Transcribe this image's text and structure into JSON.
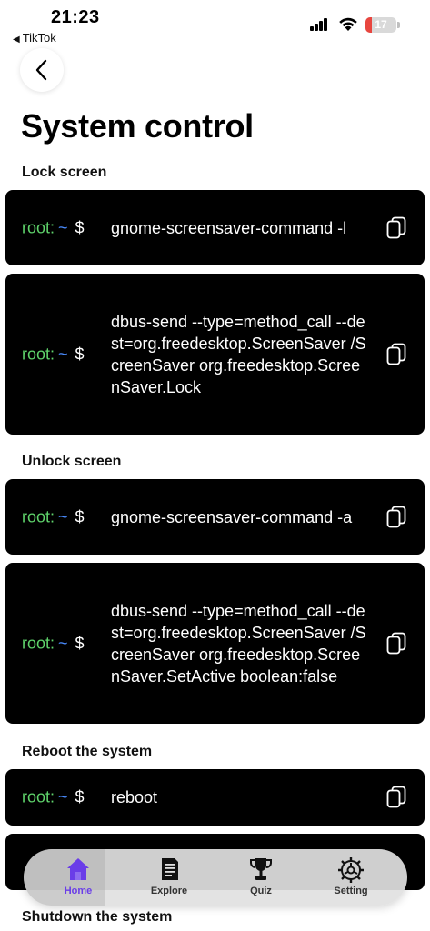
{
  "status_bar": {
    "time": "21:23",
    "back_app": "TikTok",
    "battery": "17"
  },
  "page": {
    "title": "System control"
  },
  "sections": [
    {
      "label": "Lock screen",
      "commands": [
        {
          "user": "root:",
          "tilde": "~",
          "dollar": "$",
          "text": "gnome-screensaver-command -l"
        },
        {
          "user": "root:",
          "tilde": "~",
          "dollar": "$",
          "text": "dbus-send --type=method_call --dest=org.freedesktop.ScreenSaver /ScreenSaver org.freedesktop.ScreenSaver.Lock"
        }
      ]
    },
    {
      "label": "Unlock screen",
      "commands": [
        {
          "user": "root:",
          "tilde": "~",
          "dollar": "$",
          "text": "gnome-screensaver-command -a"
        },
        {
          "user": "root:",
          "tilde": "~",
          "dollar": "$",
          "text": "dbus-send --type=method_call --dest=org.freedesktop.ScreenSaver /ScreenSaver org.freedesktop.ScreenSaver.SetActive boolean:false"
        }
      ]
    },
    {
      "label": "Reboot the system",
      "commands": [
        {
          "user": "root:",
          "tilde": "~",
          "dollar": "$",
          "text": "reboot"
        }
      ]
    },
    {
      "label": "Shutdown the system"
    }
  ],
  "tab_bar": {
    "tabs": [
      {
        "label": "Home",
        "icon": "home-icon",
        "active": true
      },
      {
        "label": "Explore",
        "icon": "document-icon"
      },
      {
        "label": "Quiz",
        "icon": "trophy-icon"
      },
      {
        "label": "Setting",
        "icon": "gear-icon"
      }
    ]
  },
  "colors": {
    "prompt_user": "#5fd36b",
    "prompt_tilde": "#4a8cff",
    "active_tab": "#6a3de8",
    "card_bg": "#000000",
    "battery_low": "#e8463f"
  }
}
